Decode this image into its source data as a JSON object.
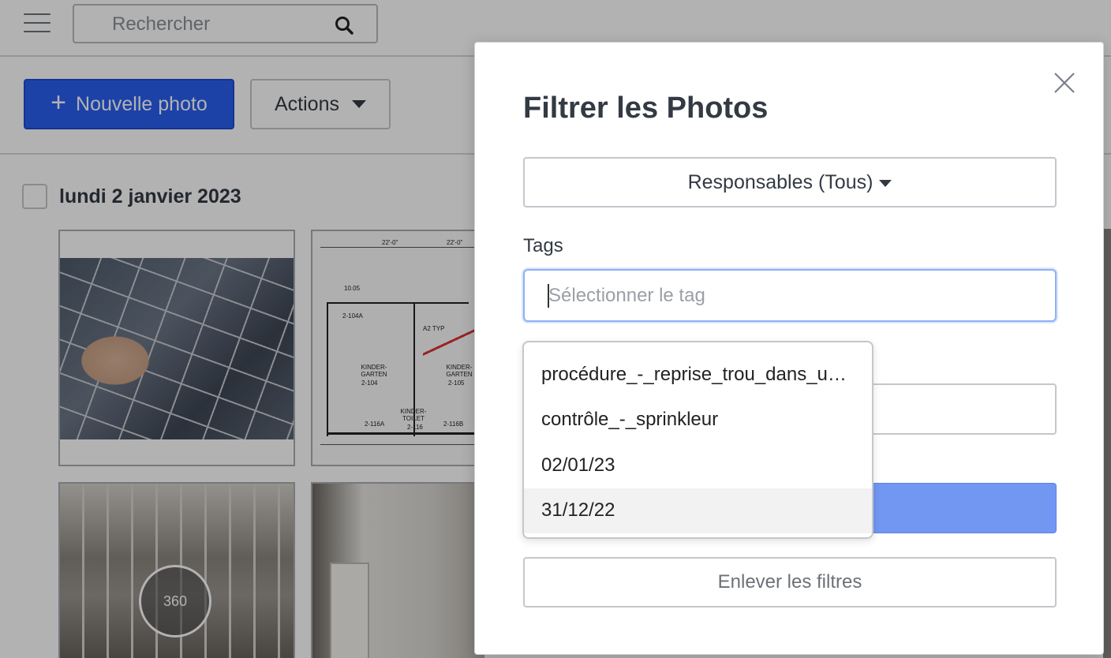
{
  "header": {
    "search_placeholder": "Rechercher"
  },
  "toolbar": {
    "new_photo_label": "Nouvelle photo",
    "actions_label": "Actions"
  },
  "gallery": {
    "date_label": "lundi 2 janvier 2023",
    "photo_badge": "360",
    "plan_labels": [
      "10.05",
      "2-104A",
      "A2 TYP",
      "KINDER-GARTEN",
      "KINDER-GARTEN",
      "KINDER-TOILET",
      "2-116A",
      "2-116B",
      "22'-0\"",
      "22'-0\"",
      "2-104",
      "2-105",
      "2-116"
    ]
  },
  "modal": {
    "title": "Filtrer les Photos",
    "responsables_label": "Responsables (Tous)",
    "tags_label": "Tags",
    "tags_placeholder": "Sélectionner le tag",
    "clear_filters_label": "Enlever les filtres",
    "tag_options": [
      "procédure_-_reprise_trou_dans_u…",
      "contrôle_-_sprinkleur",
      "02/01/23",
      "31/12/22"
    ],
    "highlighted_option_index": 3
  },
  "colors": {
    "primary": "#2a5ff0",
    "apply_button": "#7197f3",
    "focus_border": "#8fb0f5"
  }
}
